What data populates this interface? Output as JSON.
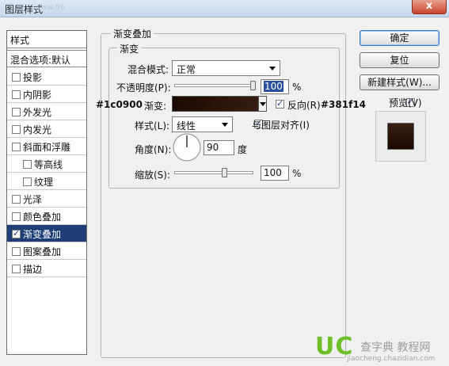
{
  "window": {
    "title": "图层样式",
    "watermark": "www.96",
    "close_label": "x"
  },
  "styles_panel": {
    "header": "样式",
    "blend_options": "混合选项:默认",
    "items": [
      {
        "label": "投影",
        "checked": false
      },
      {
        "label": "内阴影",
        "checked": false
      },
      {
        "label": "外发光",
        "checked": false
      },
      {
        "label": "内发光",
        "checked": false
      },
      {
        "label": "斜面和浮雕",
        "checked": false
      },
      {
        "label": "等高线",
        "checked": false
      },
      {
        "label": "纹理",
        "checked": false
      },
      {
        "label": "光泽",
        "checked": false
      },
      {
        "label": "颜色叠加",
        "checked": false
      },
      {
        "label": "渐变叠加",
        "checked": true
      },
      {
        "label": "图案叠加",
        "checked": false
      },
      {
        "label": "描边",
        "checked": false
      }
    ]
  },
  "gradient_overlay": {
    "section_title": "渐变叠加",
    "subsection_title": "渐变",
    "blend_mode_label": "混合模式:",
    "blend_mode_value": "正常",
    "opacity_label": "不透明度(P):",
    "opacity_value": "100",
    "opacity_unit": "%",
    "gradient_label": "渐变:",
    "reverse_label": "反向(R)",
    "reverse_checked": true,
    "style_label": "样式(L):",
    "style_value": "线性",
    "align_label": "与图层对齐(I)",
    "align_checked": true,
    "angle_label": "角度(N):",
    "angle_value": "90",
    "angle_unit": "度",
    "scale_label": "缩放(S):",
    "scale_value": "100",
    "scale_unit": "%",
    "gradient_start_color": "#1c0900",
    "gradient_end_color": "#381f14"
  },
  "annotations": {
    "left_hex": "#1c0900",
    "right_hex": "#381f14"
  },
  "buttons": {
    "ok": "确定",
    "reset": "复位",
    "new_style": "新建样式(W)...",
    "preview_label": "预览(V)",
    "preview_checked": true
  },
  "watermark": {
    "logo": "UC",
    "text": "查字典 教程网",
    "url": "jiaocheng.chazidian.com"
  }
}
